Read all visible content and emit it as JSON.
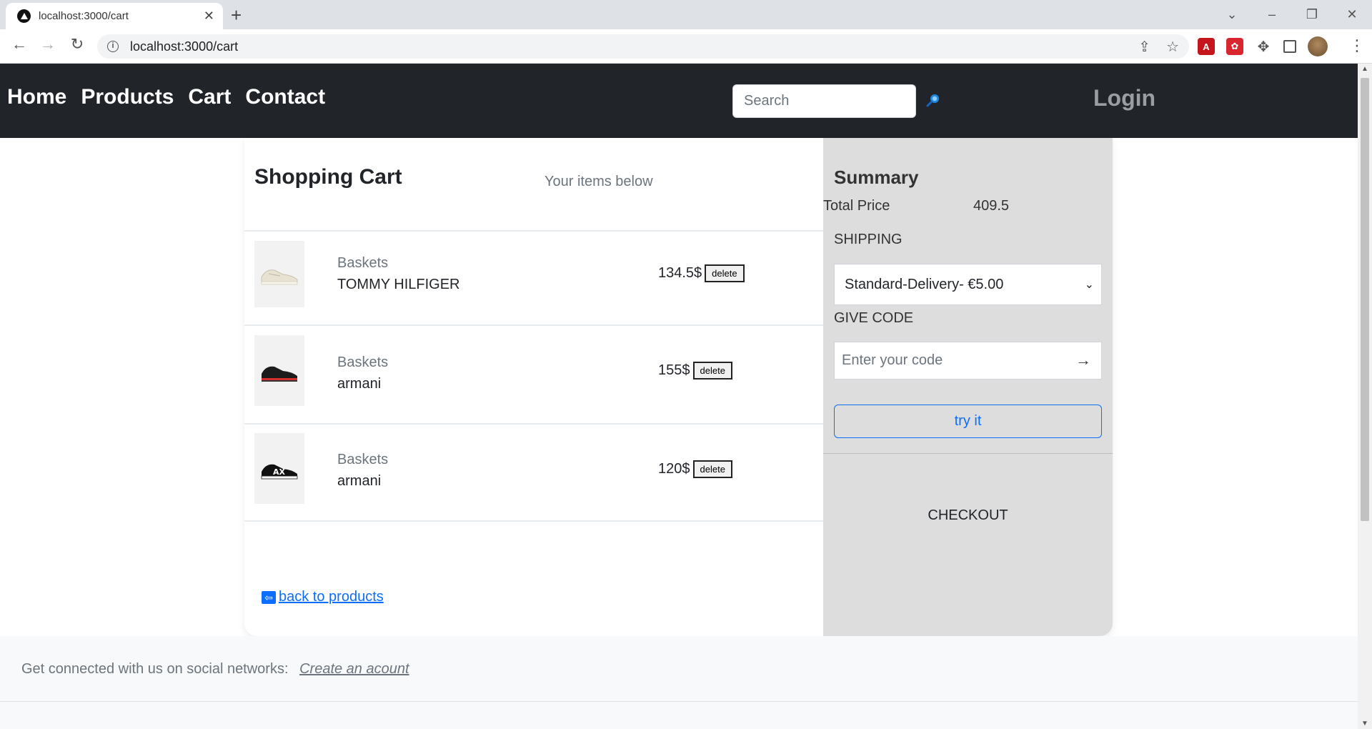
{
  "browser": {
    "tab_title": "localhost:3000/cart",
    "url": "localhost:3000/cart"
  },
  "nav": {
    "links": [
      "Home",
      "Products",
      "Cart",
      "Contact"
    ],
    "search_placeholder": "Search",
    "login": "Login"
  },
  "cart": {
    "title": "Shopping Cart",
    "subtitle": "Your items below",
    "items": [
      {
        "category": "Baskets",
        "name": "TOMMY HILFIGER",
        "price": "134.5$",
        "delete_label": "delete"
      },
      {
        "category": "Baskets",
        "name": "armani",
        "price": "155$",
        "delete_label": "delete"
      },
      {
        "category": "Baskets",
        "name": "armani",
        "price": "120$",
        "delete_label": "delete"
      }
    ],
    "back_link": "back to products"
  },
  "summary": {
    "title": "Summary",
    "total_label": "Total Price",
    "total_value": "409.5",
    "shipping_label": "SHIPPING",
    "shipping_selected": "Standard-Delivery- €5.00",
    "code_label": "GIVE CODE",
    "code_placeholder": "Enter your code",
    "try_label": "try it",
    "checkout_label": "CHECKOUT"
  },
  "footer": {
    "text": "Get connected with us on social networks:",
    "link": "Create an acount"
  },
  "colors": {
    "nav_bg": "#212529",
    "summary_bg": "#dddddd",
    "link_blue": "#0d6efd"
  }
}
